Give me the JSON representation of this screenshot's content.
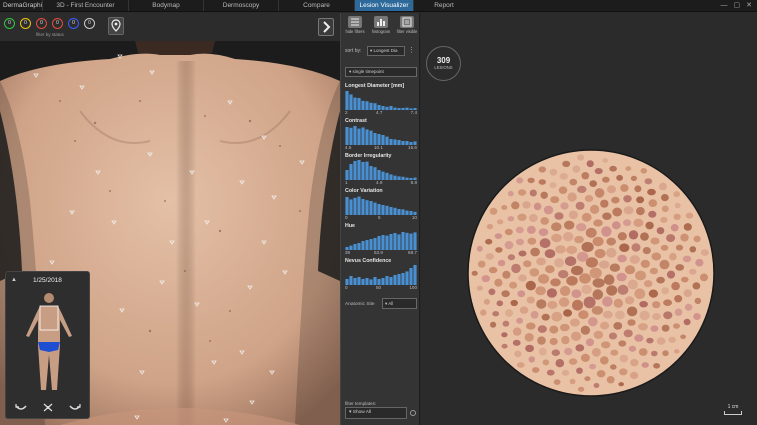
{
  "app": {
    "brand": "DermaGraphix"
  },
  "tabs": [
    {
      "label": "3D - First Encounter",
      "active": false
    },
    {
      "label": "Bodymap",
      "active": false
    },
    {
      "label": "Dermoscopy",
      "active": false
    },
    {
      "label": "Compare",
      "active": false
    },
    {
      "label": "Lesion Visualizer",
      "active": true
    },
    {
      "label": "Report",
      "active": false
    }
  ],
  "window_controls": {
    "minimize": "—",
    "maximize": "▢",
    "close": "✕"
  },
  "status_filter": {
    "label": "filter by status",
    "dots": [
      {
        "label": "0",
        "color": "#2ecc40"
      },
      {
        "label": "0",
        "color": "#f1c40f"
      },
      {
        "label": "0",
        "color": "#e74c3c"
      },
      {
        "label": "0",
        "color": "#e74c3c"
      },
      {
        "label": "0",
        "color": "#3b5bff"
      },
      {
        "label": "0",
        "color": "#cccccc"
      }
    ]
  },
  "mini_panel": {
    "collapse_icon": "▲",
    "date": "1/25/2018"
  },
  "filter_panel": {
    "tools": [
      {
        "label": "hide filters",
        "icon": "filter-list-icon"
      },
      {
        "label": "histogram",
        "icon": "histogram-icon"
      },
      {
        "label": "filter visible",
        "icon": "filter-visible-icon"
      }
    ],
    "sort_label": "sort by:",
    "sort_value": "▾ Longest Dia",
    "sort_more": "⋮",
    "timepoint": "▾ single timepoint",
    "histograms": [
      {
        "title": "Longest Diameter [mm]",
        "ticks": [
          "2",
          "4.7",
          "7.4"
        ],
        "bars": [
          0.95,
          0.78,
          0.62,
          0.6,
          0.46,
          0.44,
          0.36,
          0.34,
          0.25,
          0.2,
          0.16,
          0.2,
          0.12,
          0.1,
          0.1,
          0.12,
          0.08,
          0.1
        ]
      },
      {
        "title": "Contrast",
        "ticks": [
          "4.5",
          "10.1",
          "15.6"
        ],
        "bars": [
          0.9,
          0.86,
          0.95,
          0.82,
          0.88,
          0.78,
          0.72,
          0.6,
          0.55,
          0.5,
          0.42,
          0.3,
          0.28,
          0.25,
          0.2,
          0.2,
          0.15,
          0.18
        ]
      },
      {
        "title": "Border Irregularity",
        "ticks": [
          "1",
          "4.9",
          "8.8"
        ],
        "bars": [
          0.5,
          0.8,
          0.95,
          1.0,
          0.9,
          0.92,
          0.7,
          0.64,
          0.5,
          0.42,
          0.36,
          0.28,
          0.22,
          0.18,
          0.16,
          0.12,
          0.1,
          0.12
        ]
      },
      {
        "title": "Color Variation",
        "ticks": [
          "0",
          "5",
          "10"
        ],
        "bars": [
          0.9,
          0.78,
          0.86,
          0.92,
          0.8,
          0.74,
          0.7,
          0.62,
          0.55,
          0.5,
          0.46,
          0.4,
          0.36,
          0.3,
          0.28,
          0.22,
          0.2,
          0.16
        ]
      },
      {
        "title": "Hue",
        "ticks": [
          "39",
          "53.9",
          "68.7"
        ],
        "bars": [
          0.15,
          0.22,
          0.3,
          0.35,
          0.45,
          0.5,
          0.55,
          0.6,
          0.7,
          0.75,
          0.72,
          0.8,
          0.85,
          0.78,
          0.9,
          0.86,
          0.82,
          0.88
        ]
      },
      {
        "title": "Nevus Confidence",
        "ticks": [
          "0",
          "50",
          "100"
        ],
        "bars": [
          0.3,
          0.45,
          0.35,
          0.4,
          0.3,
          0.35,
          0.28,
          0.4,
          0.3,
          0.35,
          0.45,
          0.4,
          0.5,
          0.55,
          0.6,
          0.68,
          0.85,
          1.0
        ]
      }
    ],
    "anatomic_label": "Anatomic Site",
    "anatomic_value": "▾ All",
    "templates_label": "filter templates:",
    "templates_value": "▾ Show All"
  },
  "visualizer": {
    "count": "309",
    "count_label": "LESIONS",
    "scale_label": "1 cm"
  },
  "colors": {
    "accent": "#2d6a9b",
    "bar_blue": "#4a8fd0",
    "skin_disc": "#e9c2a6",
    "background": "#2b2b2b"
  }
}
